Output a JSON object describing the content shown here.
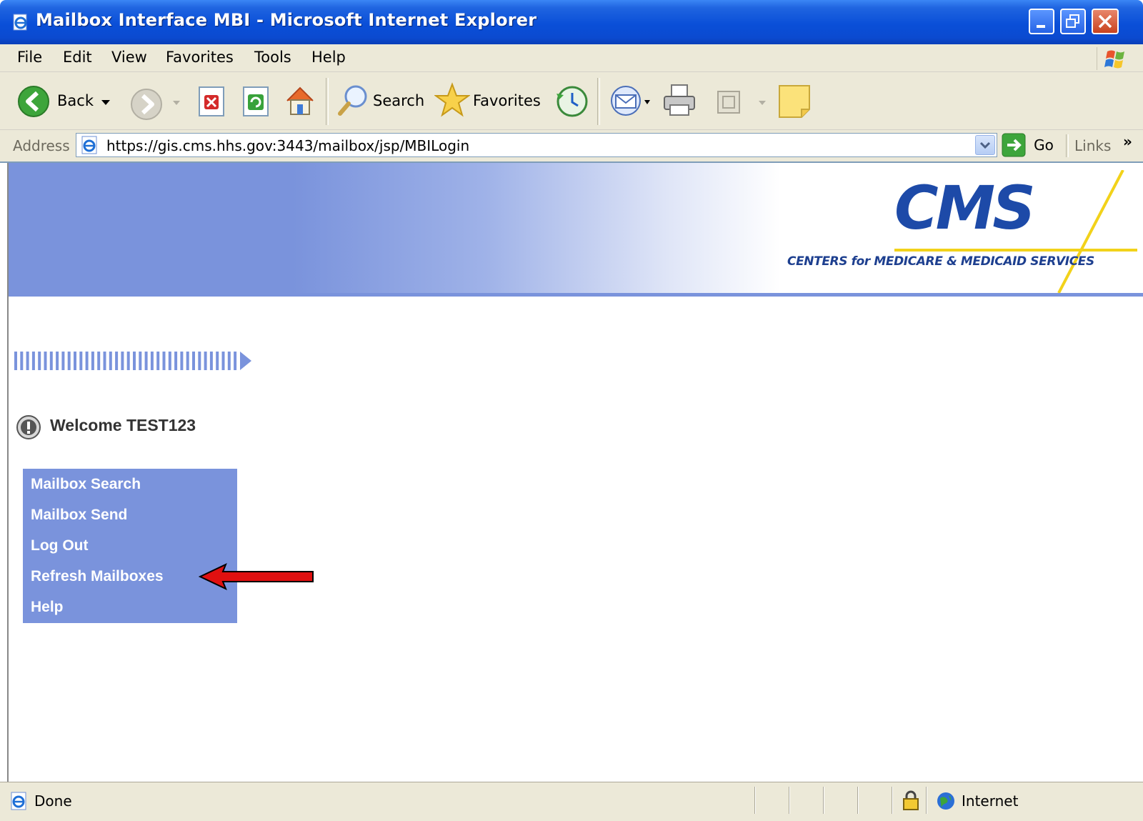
{
  "window": {
    "title": "Mailbox Interface MBI - Microsoft Internet Explorer"
  },
  "menu": {
    "items": [
      {
        "label": "File"
      },
      {
        "label": "Edit"
      },
      {
        "label": "View"
      },
      {
        "label": "Favorites"
      },
      {
        "label": "Tools"
      },
      {
        "label": "Help"
      }
    ]
  },
  "toolbar": {
    "back_label": "Back",
    "search_label": "Search",
    "favorites_label": "Favorites"
  },
  "address": {
    "label": "Address",
    "url": "https://gis.cms.hhs.gov:3443/mailbox/jsp/MBILogin",
    "go_label": "Go",
    "links_label": "Links"
  },
  "banner": {
    "logo_text": "CMS",
    "tagline": "CENTERS for MEDICARE & MEDICAID SERVICES",
    "colors": {
      "logo": "#1d4aa8",
      "accent": "#f2d21a",
      "banner": "#7a93dc"
    }
  },
  "page": {
    "welcome": "Welcome TEST123",
    "nav": [
      {
        "label": "Mailbox Search"
      },
      {
        "label": "Mailbox Send"
      },
      {
        "label": "Log Out"
      },
      {
        "label": "Refresh Mailboxes"
      },
      {
        "label": "Help"
      }
    ]
  },
  "status": {
    "text": "Done",
    "zone": "Internet"
  }
}
